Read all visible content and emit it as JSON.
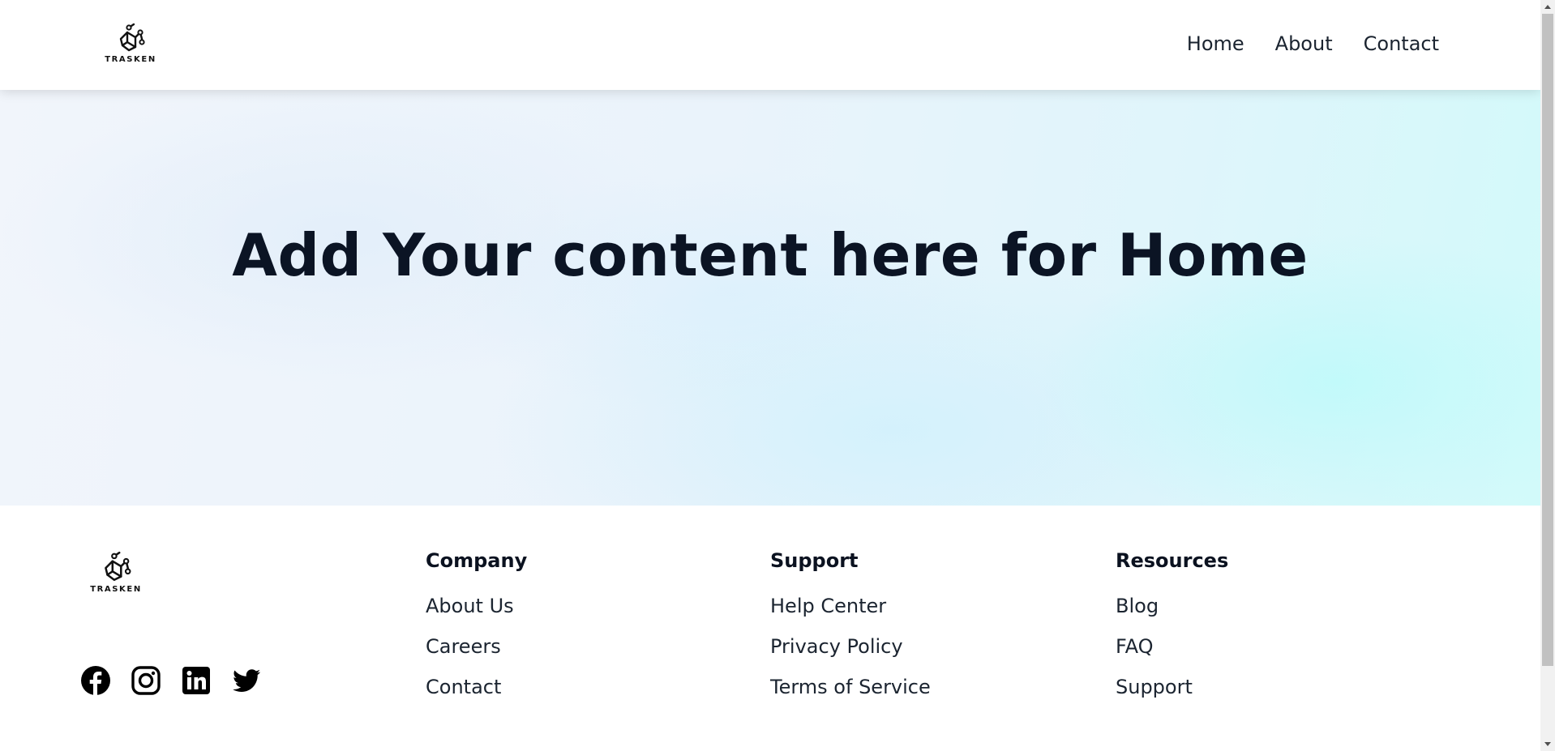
{
  "brand": {
    "name": "TRASKEN"
  },
  "nav": {
    "items": [
      "Home",
      "About",
      "Contact"
    ]
  },
  "hero": {
    "title": "Add Your content here for Home"
  },
  "footer": {
    "columns": [
      {
        "heading": "Company",
        "links": [
          "About Us",
          "Careers",
          "Contact"
        ]
      },
      {
        "heading": "Support",
        "links": [
          "Help Center",
          "Privacy Policy",
          "Terms of Service"
        ]
      },
      {
        "heading": "Resources",
        "links": [
          "Blog",
          "FAQ",
          "Support"
        ]
      }
    ],
    "social_icons": [
      "facebook-icon",
      "instagram-icon",
      "linkedin-icon",
      "twitter-icon"
    ]
  },
  "colors": {
    "heading": "#0b1424",
    "text": "#1b2430",
    "hero_accent": "#d2fafa"
  }
}
